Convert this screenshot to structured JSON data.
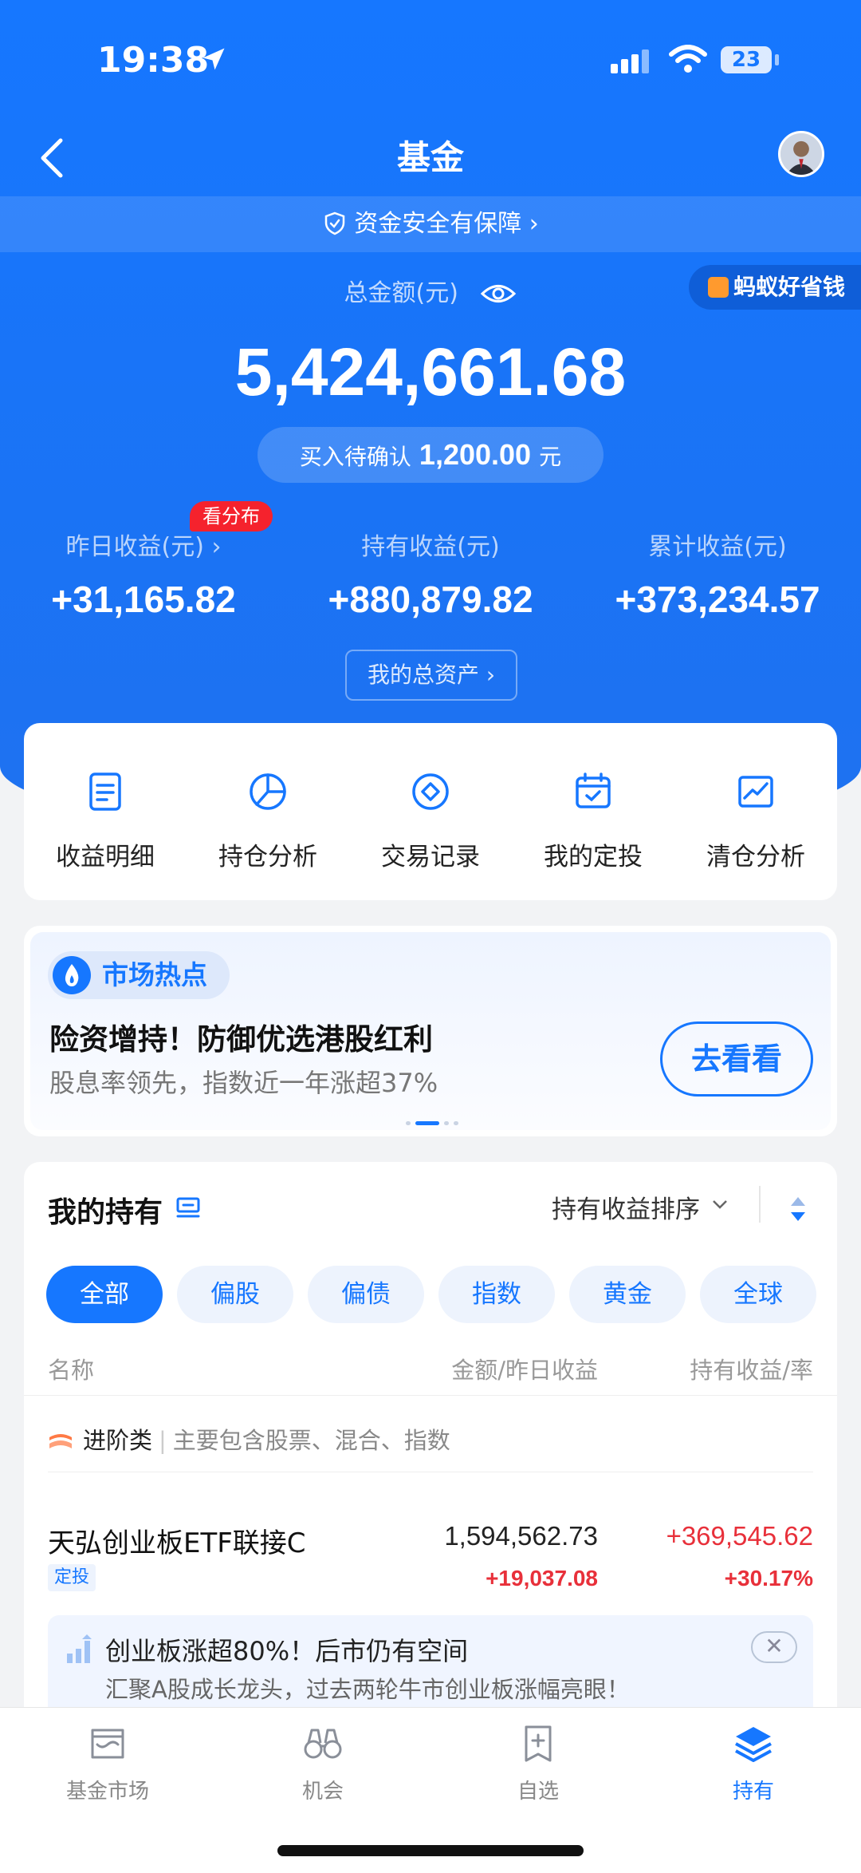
{
  "status_bar": {
    "time": "19:38",
    "battery": "23"
  },
  "nav": {
    "title": "基金"
  },
  "safety_banner": {
    "text": "资金安全有保障 ›"
  },
  "promo_tag": {
    "text": "蚂蚁好省钱"
  },
  "summary": {
    "total_label": "总金额(元)",
    "total_value": "5,424,661.68",
    "pending_label": "买入待确认",
    "pending_amount": "1,200.00",
    "pending_unit": "元",
    "distribution_badge": "看分布",
    "stats": [
      {
        "label": "昨日收益(元) ›",
        "value": "+31,165.82"
      },
      {
        "label": "持有收益(元)",
        "value": "+880,879.82"
      },
      {
        "label": "累计收益(元)",
        "value": "+373,234.57"
      }
    ],
    "my_assets_button": "我的总资产 ›"
  },
  "tools": [
    {
      "label": "收益明细",
      "icon": "document-icon"
    },
    {
      "label": "持仓分析",
      "icon": "pie-chart-icon"
    },
    {
      "label": "交易记录",
      "icon": "diamond-icon"
    },
    {
      "label": "我的定投",
      "icon": "calendar-check-icon"
    },
    {
      "label": "清仓分析",
      "icon": "line-chart-icon"
    }
  ],
  "market_hot": {
    "pill": "市场热点",
    "headline": "险资增持！防御优选港股红利",
    "subline": "股息率领先，指数近一年涨超37%",
    "button": "去看看"
  },
  "holdings": {
    "title": "我的持有",
    "sort_label": "持有收益排序",
    "filters": [
      "全部",
      "偏股",
      "偏债",
      "指数",
      "黄金",
      "全球"
    ],
    "active_filter": 0,
    "columns": [
      "名称",
      "金额/昨日收益",
      "持有收益/率"
    ],
    "category": {
      "name": "进阶类",
      "desc": "主要包含股票、混合、指数"
    },
    "funds": [
      {
        "name": "天弘创业板ETF联接C",
        "badge": "定投",
        "amount": "1,594,562.73",
        "day_profit": "+19,037.08",
        "hold_profit": "+369,545.62",
        "hold_rate": "+30.17%"
      }
    ],
    "tip": {
      "title": "创业板涨超80%！后市仍有空间",
      "desc": "汇聚A股成长龙头，过去两轮牛市创业板涨幅亮眼！",
      "close": "✕"
    }
  },
  "bottom_nav": [
    {
      "label": "基金市场",
      "icon": "storefront-icon"
    },
    {
      "label": "机会",
      "icon": "binoculars-icon"
    },
    {
      "label": "自选",
      "icon": "bookmark-add-icon"
    },
    {
      "label": "持有",
      "icon": "layers-icon"
    }
  ],
  "colors": {
    "brand_blue": "#1677ff",
    "profit_red": "#e8303a",
    "badge_red": "#f5222d"
  }
}
